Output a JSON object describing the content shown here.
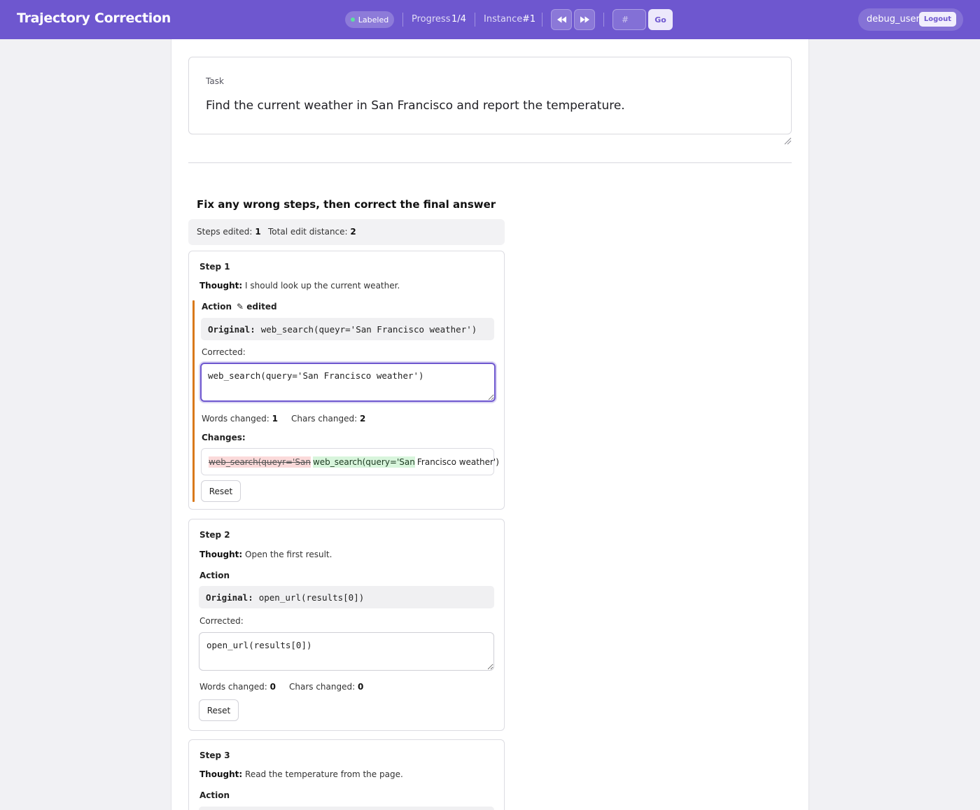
{
  "header": {
    "title": "Trajectory Correction",
    "status": "Labeled",
    "progress_label": "Progress",
    "progress_value": "1/4",
    "instance_label": "Instance",
    "instance_value": "#1",
    "jump_placeholder": "#",
    "go_label": "Go",
    "username": "debug_user",
    "logout_label": "Logout",
    "status_color": "#5ee0a0",
    "accent_color": "#6e57cf"
  },
  "task": {
    "label": "Task",
    "text": "Find the current weather in San Francisco and report the temperature."
  },
  "section": {
    "title": "Fix any wrong steps, then correct the final answer",
    "steps_edited_label": "Steps edited:",
    "steps_edited_value": "1",
    "total_edit_label": "Total edit distance:",
    "total_edit_value": "2"
  },
  "steps": [
    {
      "title": "Step 1",
      "thought_label": "Thought:",
      "thought": "I should look up the current weather.",
      "action_label": "Action",
      "edited_tag": "✎ edited",
      "original_label": "Original:",
      "original": "web_search(queyr='San Francisco weather')",
      "corrected_label": "Corrected:",
      "corrected": "web_search(query='San Francisco weather')",
      "words_changed_label": "Words changed:",
      "words_changed": "1",
      "chars_changed_label": "Chars changed:",
      "chars_changed": "2",
      "changes_label": "Changes:",
      "diff_deleted": "web_search(queyr='San",
      "diff_inserted": "web_search(query='San",
      "diff_unchanged": "Francisco weather')",
      "reset_label": "Reset",
      "edit_marker_color": "#d9791b"
    },
    {
      "title": "Step 2",
      "thought_label": "Thought:",
      "thought": "Open the first result.",
      "action_label": "Action",
      "original_label": "Original:",
      "original": "open_url(results[0])",
      "corrected_label": "Corrected:",
      "corrected": "open_url(results[0])",
      "words_changed_label": "Words changed:",
      "words_changed": "0",
      "chars_changed_label": "Chars changed:",
      "chars_changed": "0",
      "reset_label": "Reset"
    },
    {
      "title": "Step 3",
      "thought_label": "Thought:",
      "thought": "Read the temperature from the page.",
      "action_label": "Action"
    }
  ]
}
